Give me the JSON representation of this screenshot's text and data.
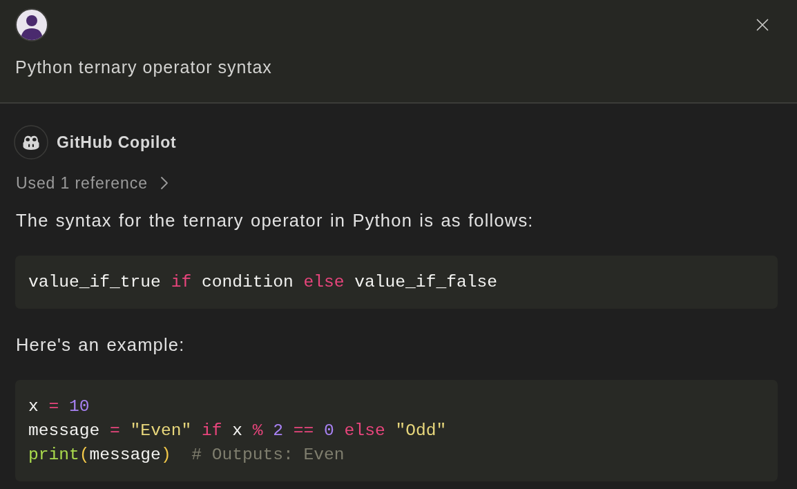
{
  "header": {
    "title": "Python ternary operator syntax"
  },
  "response": {
    "author": "GitHub Copilot",
    "references": {
      "label": "Used 1 reference",
      "expanded": false
    },
    "content": [
      {
        "kind": "paragraph",
        "text": "The syntax for the ternary operator in Python is as follows:"
      },
      {
        "kind": "code",
        "lines": [
          [
            {
              "text": "value_if_true ",
              "kind": "plain"
            },
            {
              "text": "if",
              "kind": "keyword"
            },
            {
              "text": " condition ",
              "kind": "plain"
            },
            {
              "text": "else",
              "kind": "keyword"
            },
            {
              "text": " value_if_false",
              "kind": "plain"
            }
          ]
        ]
      },
      {
        "kind": "paragraph",
        "text": "Here's an example:"
      },
      {
        "kind": "code",
        "lines": [
          [
            {
              "text": "x ",
              "kind": "plain"
            },
            {
              "text": "= ",
              "kind": "operator"
            },
            {
              "text": "10",
              "kind": "number"
            }
          ],
          [
            {
              "text": "message ",
              "kind": "plain"
            },
            {
              "text": "= ",
              "kind": "operator"
            },
            {
              "text": "\"Even\" ",
              "kind": "string"
            },
            {
              "text": "if ",
              "kind": "keyword"
            },
            {
              "text": "x ",
              "kind": "plain"
            },
            {
              "text": "% ",
              "kind": "operator"
            },
            {
              "text": "2 ",
              "kind": "number"
            },
            {
              "text": "== ",
              "kind": "operator"
            },
            {
              "text": "0 ",
              "kind": "number"
            },
            {
              "text": "else ",
              "kind": "keyword"
            },
            {
              "text": "\"Odd\"",
              "kind": "string"
            }
          ],
          [
            {
              "text": "print",
              "kind": "function"
            },
            {
              "text": "(",
              "kind": "paren"
            },
            {
              "text": "message",
              "kind": "plain"
            },
            {
              "text": ")  ",
              "kind": "paren"
            },
            {
              "text": "# Outputs: Even",
              "kind": "comment"
            }
          ]
        ]
      }
    ]
  }
}
